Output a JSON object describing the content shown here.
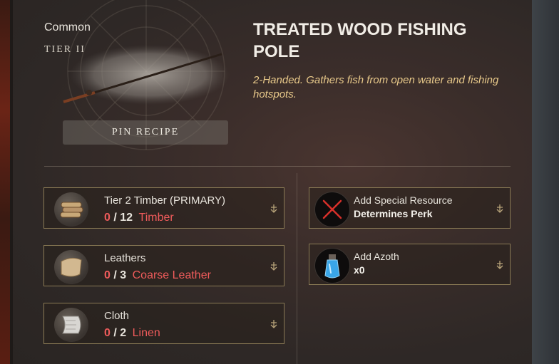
{
  "item": {
    "rarity": "Common",
    "tier": "TIER II",
    "title": "TREATED WOOD FISHING POLE",
    "description": "2-Handed. Gathers fish from open water and fishing hotspots.",
    "pin_label": "PIN RECIPE"
  },
  "ingredients": [
    {
      "name": "Tier 2 Timber (PRIMARY)",
      "have": "0",
      "sep": "/",
      "need": "12",
      "resource": "Timber",
      "icon": "timber-icon"
    },
    {
      "name": "Leathers",
      "have": "0",
      "sep": "/",
      "need": "3",
      "resource": "Coarse Leather",
      "icon": "leather-icon"
    },
    {
      "name": "Cloth",
      "have": "0",
      "sep": "/",
      "need": "2",
      "resource": "Linen",
      "icon": "linen-icon"
    }
  ],
  "extras": [
    {
      "name": "Add Special Resource",
      "sub": "Determines Perk",
      "icon": "empty-slot-x-icon"
    },
    {
      "name": "Add Azoth",
      "sub": "x0",
      "icon": "azoth-flask-icon"
    }
  ],
  "colors": {
    "missing": "#ef5b5b",
    "description": "#e8c98a",
    "slot_border": "#8a7a55"
  }
}
